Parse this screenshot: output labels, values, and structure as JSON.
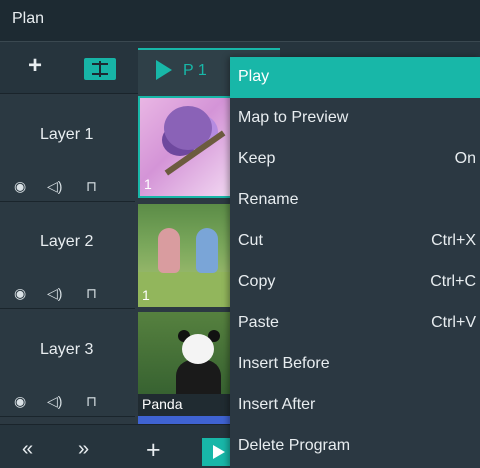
{
  "window": {
    "title": "Plan"
  },
  "toolbar": {
    "add_label": "+"
  },
  "program_tab": {
    "label": "P 1"
  },
  "layers": [
    {
      "name": "Layer 1",
      "thumb_label": "1"
    },
    {
      "name": "Layer 2",
      "thumb_label": "1"
    },
    {
      "name": "Layer 3",
      "thumb_label": "Panda"
    }
  ],
  "bottom": {
    "prev": "«",
    "next": "»",
    "add": "+"
  },
  "icons": {
    "add": "plus-icon",
    "split": "split-icon",
    "eye": "eye-icon",
    "speaker": "speaker-icon",
    "lock": "lock-icon",
    "play": "play-icon"
  },
  "accent_color": "#18b7a8",
  "context_menu": [
    {
      "label": "Play",
      "shortcut": "",
      "active": true
    },
    {
      "label": "Map to Preview",
      "shortcut": ""
    },
    {
      "label": "Keep",
      "shortcut": "On"
    },
    {
      "label": "Rename",
      "shortcut": ""
    },
    {
      "label": "Cut",
      "shortcut": "Ctrl+X"
    },
    {
      "label": "Copy",
      "shortcut": "Ctrl+C"
    },
    {
      "label": "Paste",
      "shortcut": "Ctrl+V"
    },
    {
      "label": "Insert Before",
      "shortcut": ""
    },
    {
      "label": "Insert After",
      "shortcut": ""
    },
    {
      "label": "Delete Program",
      "shortcut": ""
    }
  ]
}
